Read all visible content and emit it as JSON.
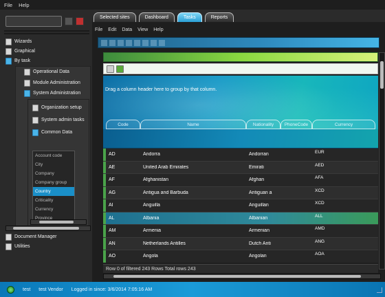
{
  "app_menu": [
    "File",
    "Help"
  ],
  "nav": {
    "items": [
      "Wizards",
      "Graphical",
      "By task"
    ],
    "sub": [
      "Operational Data",
      "Module Administration",
      "System Administration"
    ],
    "sub2": [
      "Organization setup",
      "System admin tasks",
      "Common Data"
    ],
    "common_list": [
      "Account code",
      "City",
      "Company",
      "Company group",
      "Country",
      "Criticality",
      "Currency",
      "Province"
    ],
    "selected_list": "Country",
    "bottom_items": [
      "Document Manager",
      "Utilities"
    ]
  },
  "tabs": [
    "Selected sites",
    "Dashboard",
    "Tasks",
    "Reports"
  ],
  "active_tab": "Tasks",
  "inner_menu": [
    "File",
    "Edit",
    "Data",
    "View",
    "Help"
  ],
  "grid": {
    "group_hint": "Drag a column header here to group by that column.",
    "columns": [
      "Code",
      "Name",
      "Nationality",
      "PhoneCode",
      "Currency"
    ],
    "rows": [
      {
        "code": "AD",
        "name": "Andorra",
        "nat": "Andorran",
        "phone": "",
        "cur": "EUR"
      },
      {
        "code": "AE",
        "name": "United Arab Emirates",
        "nat": "Emirati",
        "phone": "",
        "cur": "AED"
      },
      {
        "code": "AF",
        "name": "Afghanistan",
        "nat": "Afghan",
        "phone": "",
        "cur": "AFA"
      },
      {
        "code": "AG",
        "name": "Antigua and Barbuda",
        "nat": "Antiguan a",
        "phone": "",
        "cur": "XCD"
      },
      {
        "code": "AI",
        "name": "Anguilla",
        "nat": "Anguillan",
        "phone": "",
        "cur": "XCD"
      },
      {
        "code": "AL",
        "name": "Albania",
        "nat": "Albanian",
        "phone": "",
        "cur": "ALL"
      },
      {
        "code": "AM",
        "name": "Armenia",
        "nat": "Armenian",
        "phone": "",
        "cur": "AMD"
      },
      {
        "code": "AN",
        "name": "Netherlands Antilles",
        "nat": "Dutch Anti",
        "phone": "",
        "cur": "ANG"
      },
      {
        "code": "AO",
        "name": "Angola",
        "nat": "Angolan",
        "phone": "",
        "cur": "AOA"
      }
    ],
    "selected_row": 5,
    "status": "Row 0 of filtered 243 Rows  Total rows 243"
  },
  "statusbar": {
    "user": "test",
    "vendor": "test Vendor",
    "login": "Logged in since: 3/6/2014 7:05:16 AM"
  }
}
